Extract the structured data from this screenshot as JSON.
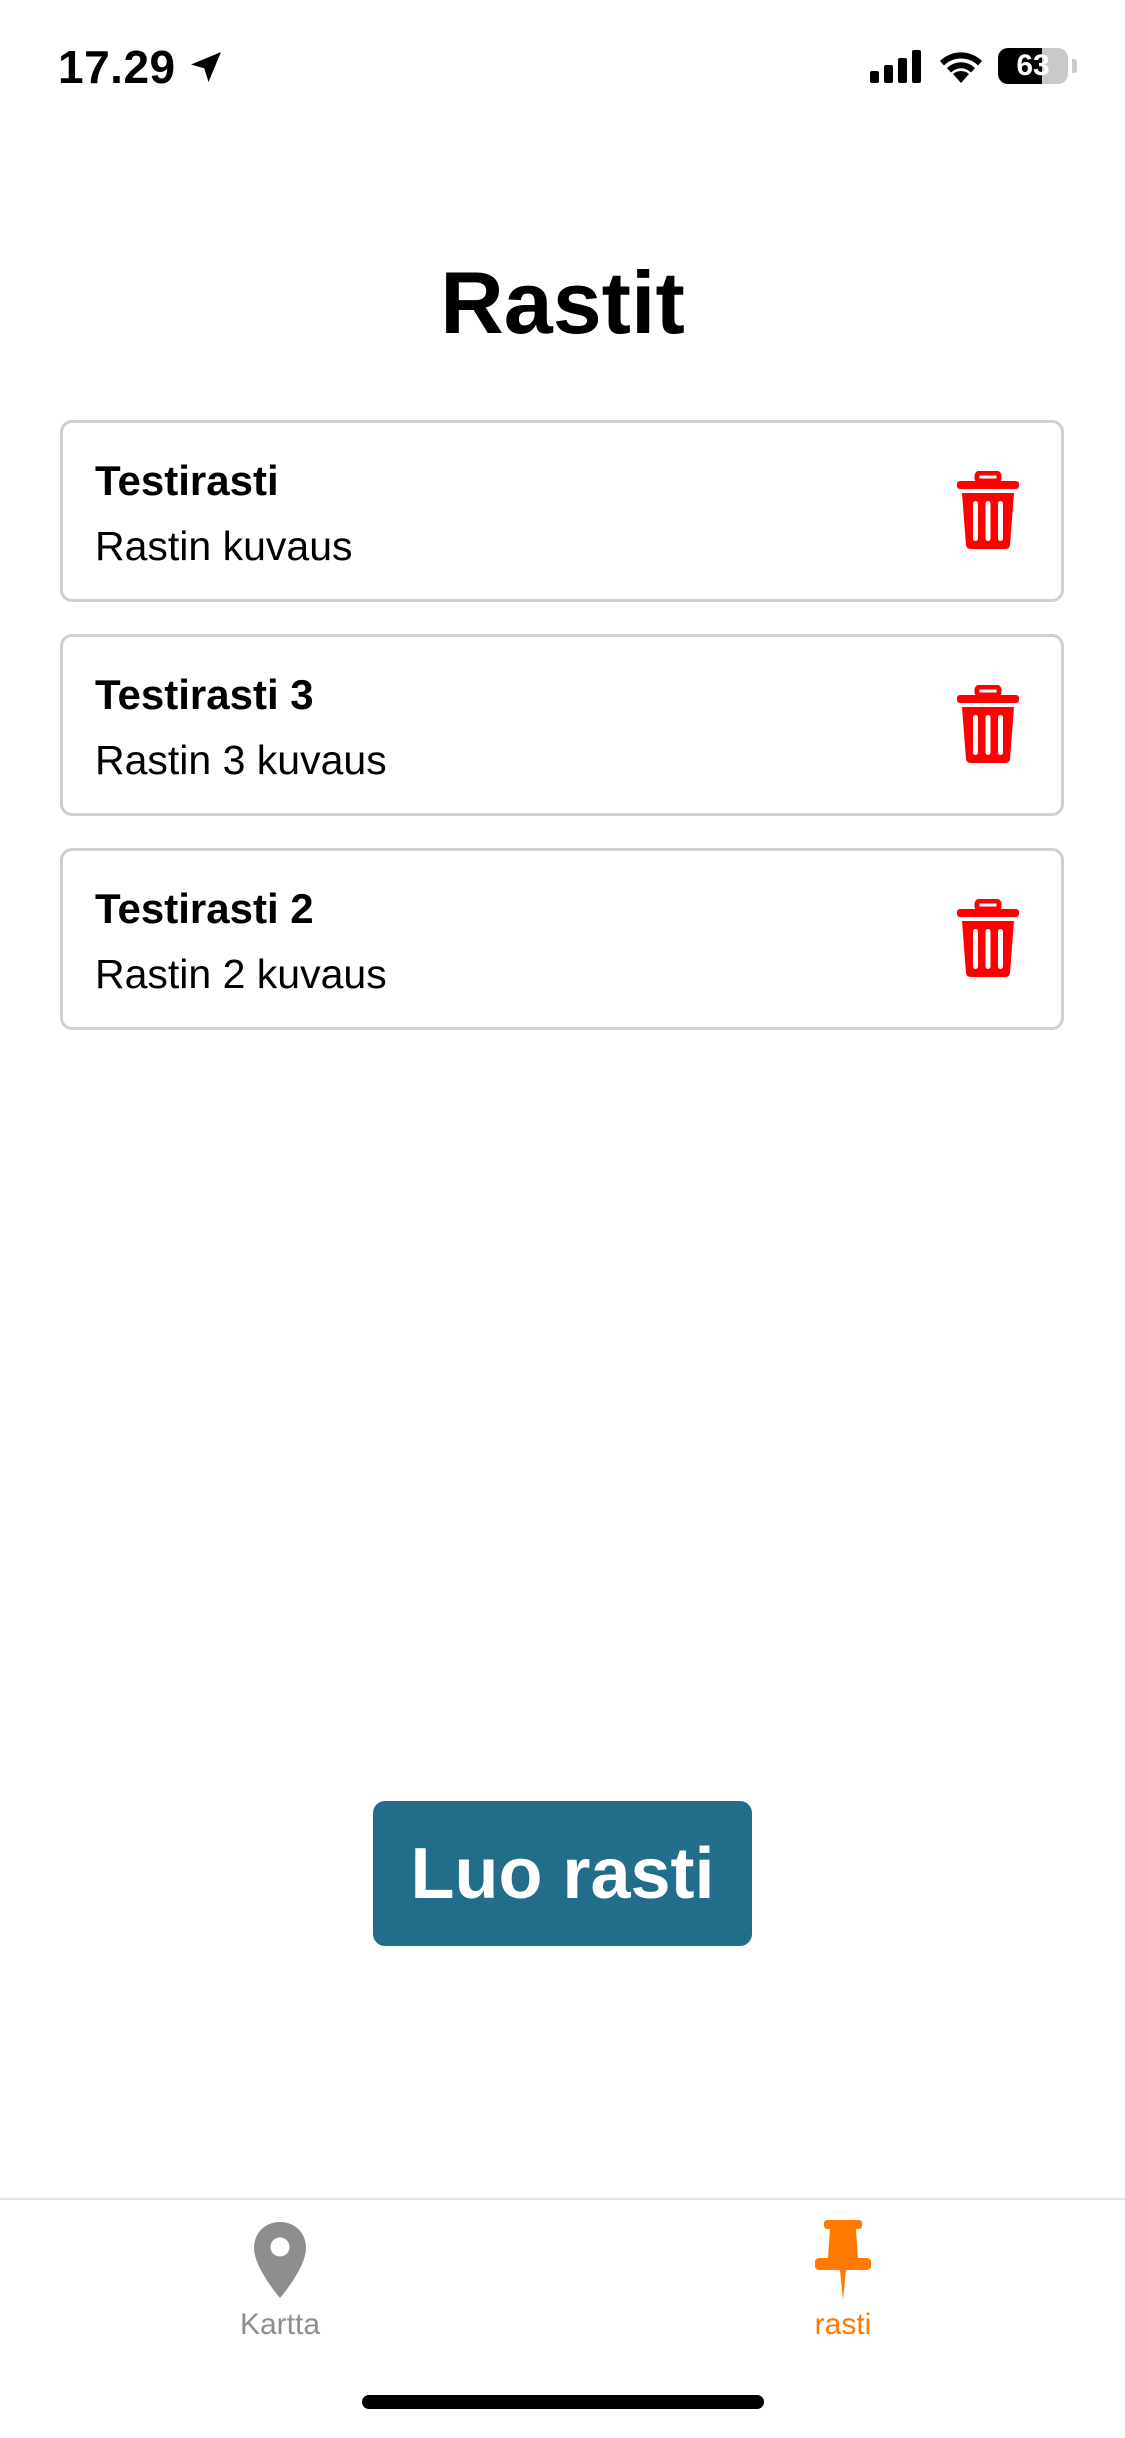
{
  "status_bar": {
    "time": "17.29",
    "battery_level": "63"
  },
  "page": {
    "title": "Rastit"
  },
  "checkpoints": [
    {
      "title": "Testirasti",
      "description": "Rastin kuvaus"
    },
    {
      "title": "Testirasti 3",
      "description": "Rastin 3 kuvaus"
    },
    {
      "title": "Testirasti 2",
      "description": "Rastin 2 kuvaus"
    }
  ],
  "create_button": {
    "label": "Luo rasti"
  },
  "tab_bar": {
    "tabs": [
      {
        "label": "Kartta",
        "icon": "map-pin-icon",
        "active": false
      },
      {
        "label": "rasti",
        "icon": "pushpin-icon",
        "active": true
      }
    ]
  },
  "colors": {
    "button": "#226e8a",
    "delete": "#ff0000",
    "tab_active": "#ff7a00",
    "tab_inactive": "#8e8e8e",
    "card_border": "#cfcfcf"
  }
}
